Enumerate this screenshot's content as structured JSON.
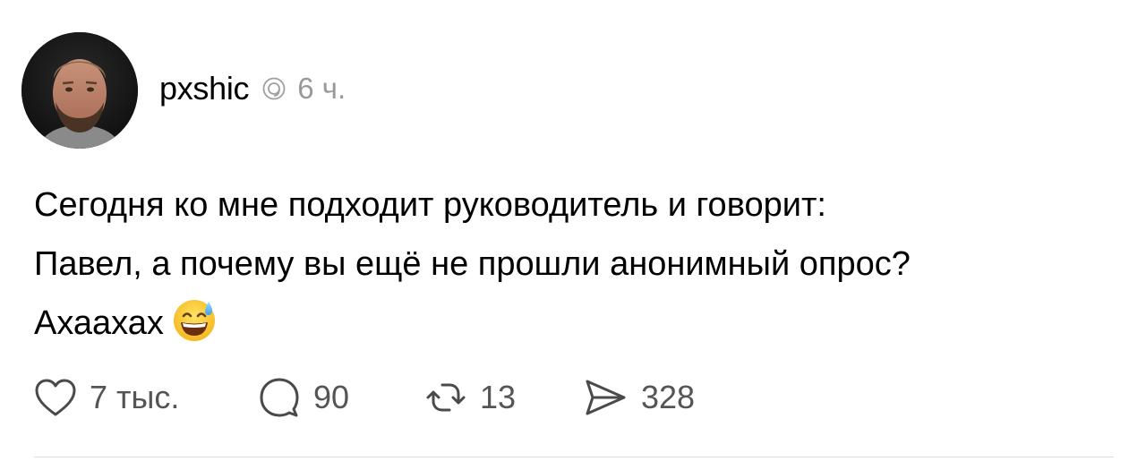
{
  "post": {
    "author": {
      "username": "pxshic",
      "avatar_icon": "avatar-photo",
      "badge_icon": "threads-icon"
    },
    "timestamp": "6 ч.",
    "text_lines": [
      "Сегодня ко мне подходит руководитель и говорит:",
      "Павел, а почему вы ещё не прошли анонимный опрос?",
      "Ахаахах"
    ],
    "emoji": "grinning-face-with-sweat-emoji",
    "actions": {
      "like": {
        "icon": "heart-icon",
        "count": "7 тыс."
      },
      "comment": {
        "icon": "comment-icon",
        "count": "90"
      },
      "repost": {
        "icon": "repost-icon",
        "count": "13"
      },
      "share": {
        "icon": "send-icon",
        "count": "328"
      }
    }
  },
  "colors": {
    "text": "#000000",
    "muted": "#999999",
    "counts": "#555555",
    "divider": "#dbdbdb"
  }
}
